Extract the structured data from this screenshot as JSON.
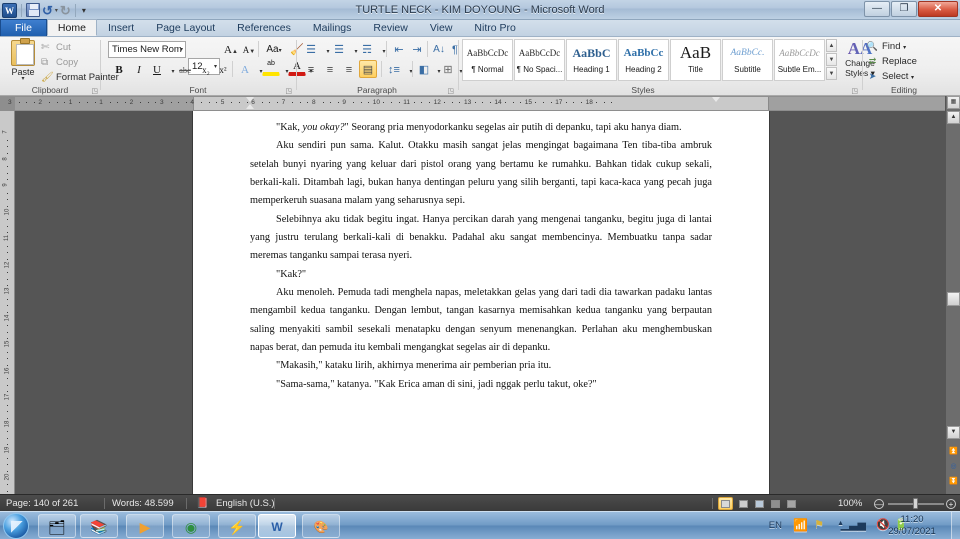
{
  "window": {
    "title": "TURTLE NECK - KIM DOYOUNG  -  Microsoft Word",
    "minimize": "—",
    "restore": "❐",
    "close": "✕"
  },
  "quick_access": {
    "app_logo": "W",
    "save": "save-icon",
    "undo": "↺",
    "redo": "↻",
    "customize": "▾"
  },
  "tabs": [
    {
      "label": "File",
      "kind": "file"
    },
    {
      "label": "Home",
      "kind": "active"
    },
    {
      "label": "Insert",
      "kind": "normal"
    },
    {
      "label": "Page Layout",
      "kind": "normal"
    },
    {
      "label": "References",
      "kind": "normal"
    },
    {
      "label": "Mailings",
      "kind": "normal"
    },
    {
      "label": "Review",
      "kind": "normal"
    },
    {
      "label": "View",
      "kind": "normal"
    },
    {
      "label": "Nitro Pro",
      "kind": "normal"
    }
  ],
  "ribbon": {
    "clipboard": {
      "group_label": "Clipboard",
      "paste_label": "Paste",
      "paste_arrow": "▾",
      "cut_label": "Cut",
      "copy_label": "Copy",
      "format_painter_label": "Format Painter"
    },
    "font": {
      "group_label": "Font",
      "font_name": "Times New Rom",
      "font_size": "12",
      "grow_font": "A",
      "shrink_font": "A",
      "change_case": "Aa",
      "clear_formatting": "clear-formatting-icon",
      "bold": "B",
      "italic": "I",
      "underline": "U",
      "strikethrough": "abc",
      "subscript": "x₂",
      "superscript": "x²",
      "text_effects": "A",
      "highlight": "ab",
      "font_color": "A"
    },
    "paragraph": {
      "group_label": "Paragraph",
      "bullets": "bullets-icon",
      "numbering": "numbering-icon",
      "multilevel": "multilevel-list-icon",
      "decrease_indent": "decrease-indent-icon",
      "increase_indent": "increase-indent-icon",
      "sort": "sort-icon",
      "show_marks": "¶",
      "align_left": "align-left-icon",
      "align_center": "align-center-icon",
      "align_right": "align-right-icon",
      "justify": "justify-icon",
      "line_spacing": "line-spacing-icon",
      "shading": "shading-icon",
      "borders": "borders-icon"
    },
    "styles": {
      "group_label": "Styles",
      "items": [
        {
          "preview": "AaBbCcDc",
          "name": "¶ Normal"
        },
        {
          "preview": "AaBbCcDc",
          "name": "¶ No Spaci..."
        },
        {
          "preview": "AaBbC",
          "name": "Heading 1"
        },
        {
          "preview": "AaBbCc",
          "name": "Heading 2"
        },
        {
          "preview": "AaB",
          "name": "Title"
        },
        {
          "preview": "AaBbCc.",
          "name": "Subtitle"
        },
        {
          "preview": "AaBbCcDc",
          "name": "Subtle Em..."
        }
      ],
      "scroll_up": "▲",
      "scroll_down": "▼",
      "scroll_more": "▼",
      "change_styles_label_1": "Change",
      "change_styles_label_2": "Styles",
      "change_styles_arrow": "▾"
    },
    "editing": {
      "group_label": "Editing",
      "find_label": "Find",
      "find_arrow": "▾",
      "replace_label": "Replace",
      "select_label": "Select",
      "select_arrow": "▾"
    }
  },
  "ruler": {
    "tab_stop_marker": "L",
    "horizontal_ticks": [
      "3",
      "2",
      "1",
      "1",
      "2",
      "3",
      "4",
      "5",
      "6",
      "7",
      "8",
      "9",
      "10",
      "11",
      "12",
      "13",
      "14",
      "15",
      "17",
      "18"
    ],
    "vertical_ticks": [
      "7",
      "8",
      "9",
      "10",
      "11",
      "12",
      "13",
      "14",
      "15",
      "16",
      "17",
      "18",
      "19",
      "20"
    ]
  },
  "document": {
    "paragraphs": [
      "\"Kak, <i>you okay?</i>\" Seorang pria menyodorkanku segelas air putih di depanku, tapi aku hanya diam.",
      "Aku sendiri pun sama. Kalut. Otakku masih sangat jelas mengingat bagaimana Ten tiba-tiba ambruk setelah bunyi nyaring yang keluar dari pistol orang yang bertamu ke rumahku. Bahkan tidak cukup sekali, berkali-kali. Ditambah lagi, bukan hanya dentingan peluru yang silih berganti, tapi kaca-kaca yang pecah juga memperkeruh suasana malam yang seharusnya sepi.",
      "Selebihnya aku tidak begitu ingat. Hanya percikan darah yang mengenai tanganku, begitu juga di lantai yang justru terulang berkali-kali di benakku. Padahal aku sangat membencinya. Membuatku tanpa sadar meremas tanganku sampai terasa nyeri.",
      "\"Kak?\"",
      "Aku menoleh. Pemuda tadi menghela napas, meletakkan gelas yang dari tadi dia tawarkan padaku lantas mengambil kedua tanganku. Dengan lembut, tangan kasarnya memisahkan kedua tanganku yang berpautan saling menyakiti sambil sesekali menatapku dengan senyum menenangkan. Perlahan aku menghembuskan napas berat, dan pemuda itu kembali mengangkat segelas air di depanku.",
      "\"Makasih,\" kataku lirih, akhirnya menerima air pemberian pria itu.",
      "\"Sama-sama,\" katanya. \"Kak Erica aman di sini, jadi nggak perlu takut, oke?\""
    ]
  },
  "status_bar": {
    "page": "Page: 140 of 261",
    "words": "Words: 48.599",
    "proofing": "proofing-errors-icon",
    "language": "English (U.S.)",
    "views": [
      "print-layout-view",
      "full-screen-reading-view",
      "web-layout-view",
      "outline-view",
      "draft-view"
    ],
    "zoom_value": "100%",
    "zoom_out": "—",
    "zoom_in": "+"
  },
  "taskbar": {
    "start": "start-orb",
    "buttons": [
      {
        "name": "windows-explorer",
        "glyph": "🗂"
      },
      {
        "name": "media-library",
        "glyph": "📚"
      },
      {
        "name": "media-player",
        "glyph": "▶"
      },
      {
        "name": "google-chrome",
        "glyph": "◉"
      },
      {
        "name": "nitro-pro",
        "glyph": "⚡"
      },
      {
        "name": "microsoft-word",
        "glyph": "W"
      },
      {
        "name": "paint",
        "glyph": "🎨"
      }
    ],
    "tray": {
      "language": "EN",
      "network": "network-icon",
      "updates": "action-center-icon",
      "show_hidden": "▲",
      "signal": "signal-icon",
      "volume": "volume-muted-icon",
      "battery": "battery-icon",
      "time": "11:20",
      "date": "29/07/2021"
    }
  }
}
